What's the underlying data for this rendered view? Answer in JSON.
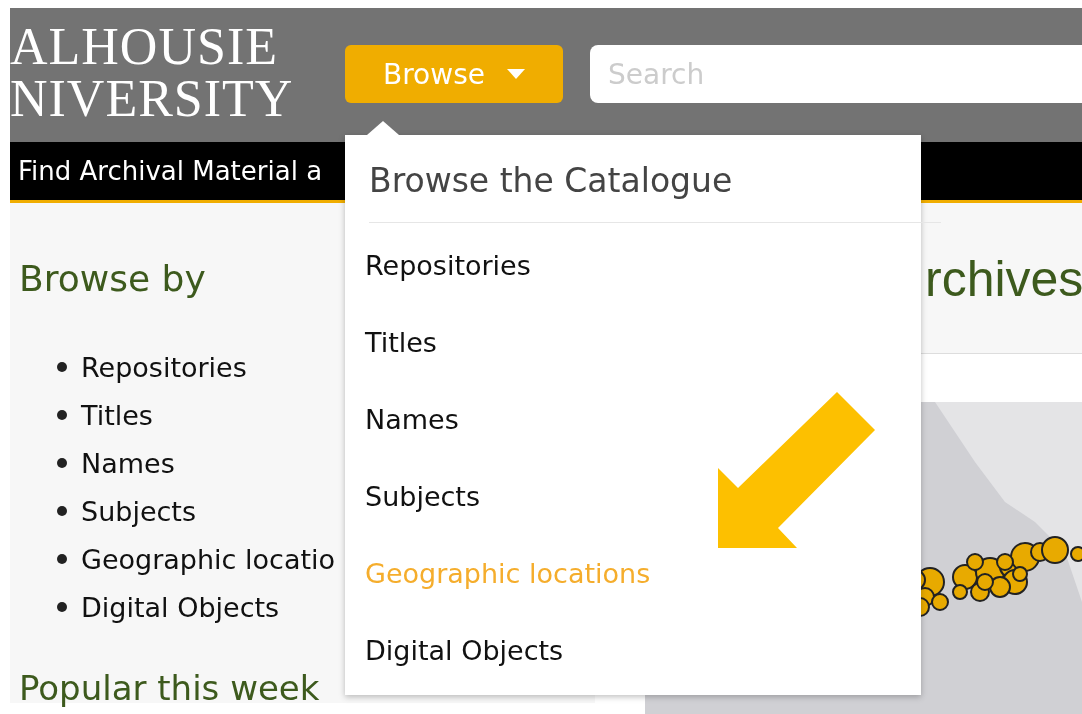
{
  "header": {
    "logo_lines": [
      "ALHOUSIE",
      "NIVERSITY"
    ],
    "browse_button": "Browse",
    "search": {
      "placeholder": "Search"
    }
  },
  "nav_bar": {
    "text": "Find Archival Material a"
  },
  "sidebar": {
    "heading": "Browse by",
    "items": [
      "Repositories",
      "Titles",
      "Names",
      "Subjects",
      "Geographic locatio",
      "Digital Objects"
    ],
    "next_heading": "Popular this week"
  },
  "main": {
    "heading": "rchives"
  },
  "dropdown": {
    "title": "Browse the Catalogue",
    "items": [
      {
        "label": "Repositories",
        "selected": false
      },
      {
        "label": "Titles",
        "selected": false
      },
      {
        "label": "Names",
        "selected": false
      },
      {
        "label": "Subjects",
        "selected": false
      },
      {
        "label": "Geographic locations",
        "selected": true
      },
      {
        "label": "Digital Objects",
        "selected": false
      }
    ]
  }
}
